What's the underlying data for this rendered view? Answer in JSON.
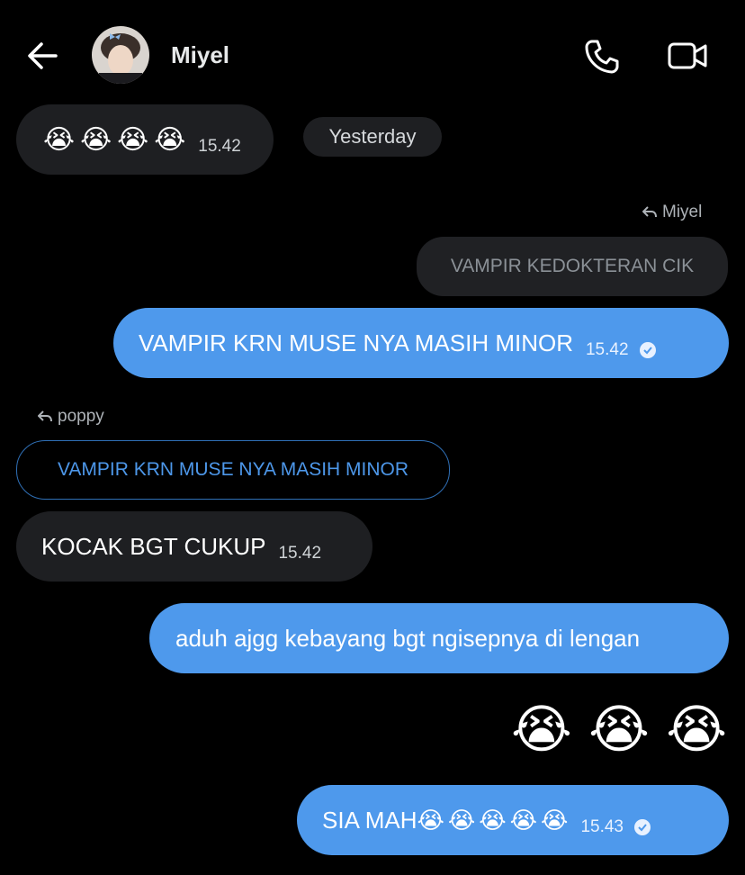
{
  "header": {
    "contact_name": "Miyel",
    "icons": [
      "back-arrow-icon",
      "phone-icon",
      "video-camera-icon"
    ]
  },
  "date_divider": "Yesterday",
  "messages": [
    {
      "from": "them",
      "emoji": [
        "😭",
        "😭",
        "😭",
        "😭"
      ],
      "time": "15.42"
    },
    {
      "from": "me",
      "reply_to_name": "Miyel",
      "reply_to_text": "VAMPIR KEDOKTERAN CIK",
      "text": "VAMPIR KRN MUSE NYA MASIH MINOR",
      "time": "15.42",
      "status": "read"
    },
    {
      "from": "them",
      "reply_to_name": "poppy",
      "reply_to_text": "VAMPIR KRN MUSE NYA MASIH MINOR",
      "text": "KOCAK BGT CUKUP",
      "time": "15.42"
    },
    {
      "from": "me",
      "text": "aduh ajgg kebayang bgt ngisepnya di lengan"
    },
    {
      "from": "me",
      "emoji": [
        "😭",
        "😭",
        "😭"
      ]
    },
    {
      "from": "me",
      "text": "SIA MAH",
      "emoji": [
        "😭",
        "😭",
        "😭",
        "😭",
        "😭"
      ],
      "time": "15.43",
      "status": "read"
    }
  ],
  "colors": {
    "background": "#000000",
    "outgoing": "#4e99ec",
    "incoming": "#1e1f22",
    "accent": "#4d97e9"
  }
}
